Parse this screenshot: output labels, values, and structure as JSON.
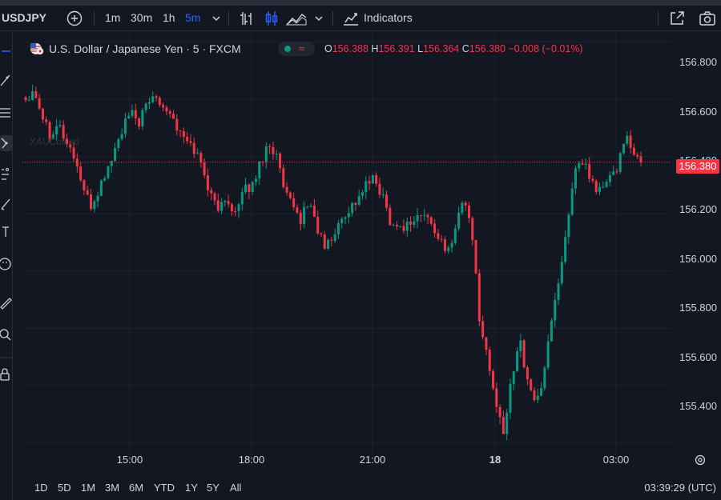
{
  "symbol": "USDJPY",
  "toolbar": {
    "timeframes": [
      {
        "label": "1m",
        "active": false
      },
      {
        "label": "30m",
        "active": false
      },
      {
        "label": "1h",
        "active": false
      },
      {
        "label": "5m",
        "active": true
      }
    ],
    "indicators_label": "Indicators",
    "icons": [
      "add-symbol-icon",
      "bar-style-icon",
      "candle-style-icon",
      "area-style-icon",
      "chevron-down-icon",
      "indicators-icon",
      "fullscreen-icon",
      "camera-icon"
    ]
  },
  "legend": {
    "title": "U.S. Dollar / Japanese Yen · 5 · FXCM",
    "open_label": "O",
    "open": "156.388",
    "high_label": "H",
    "high": "156.391",
    "low_label": "L",
    "low": "156.364",
    "close_label": "C",
    "close": "156.380",
    "change": "−0.008 (−0.01%)"
  },
  "watermark": "XAUColl.ed",
  "price_axis": {
    "labels": [
      "156.800",
      "156.600",
      "156.400",
      "156.200",
      "156.000",
      "155.800",
      "155.600",
      "155.400"
    ],
    "current_price": "156.380",
    "current_price_color": "#f23645"
  },
  "time_axis": {
    "labels": [
      {
        "text": "15:00",
        "bold": false
      },
      {
        "text": "18:00",
        "bold": false
      },
      {
        "text": "21:00",
        "bold": false
      },
      {
        "text": "18",
        "bold": true
      },
      {
        "text": "03:00",
        "bold": false
      }
    ]
  },
  "ranges": [
    "1D",
    "5D",
    "1M",
    "3M",
    "6M",
    "YTD",
    "1Y",
    "5Y",
    "All"
  ],
  "clock": "03:39:29 (UTC)",
  "colors": {
    "up": "#089981",
    "down": "#f23645",
    "background": "#131722",
    "accent": "#2962ff"
  },
  "chart_data": {
    "type": "candlestick",
    "interval": "5m",
    "ylim": [
      155.32,
      156.835
    ],
    "close_series_approx": [
      156.6,
      156.64,
      156.55,
      156.48,
      156.52,
      156.45,
      156.4,
      156.3,
      156.22,
      156.28,
      156.35,
      156.42,
      156.5,
      156.55,
      156.52,
      156.58,
      156.62,
      156.58,
      156.55,
      156.48,
      156.45,
      156.42,
      156.35,
      156.25,
      156.22,
      156.25,
      156.2,
      156.28,
      156.3,
      156.38,
      156.45,
      156.4,
      156.27,
      156.22,
      156.18,
      156.25,
      156.15,
      156.08,
      156.12,
      156.18,
      156.22,
      156.25,
      156.3,
      156.32,
      156.27,
      156.18,
      156.15,
      156.16,
      156.18,
      156.2,
      156.17,
      156.12,
      156.05,
      156.15,
      156.25,
      156.18,
      155.85,
      155.7,
      155.55,
      155.42,
      155.62,
      155.78,
      155.6,
      155.55,
      155.62,
      155.85,
      155.98,
      156.2,
      156.35,
      156.38,
      156.3,
      156.28,
      156.32,
      156.35,
      156.48,
      156.4,
      156.38
    ]
  }
}
